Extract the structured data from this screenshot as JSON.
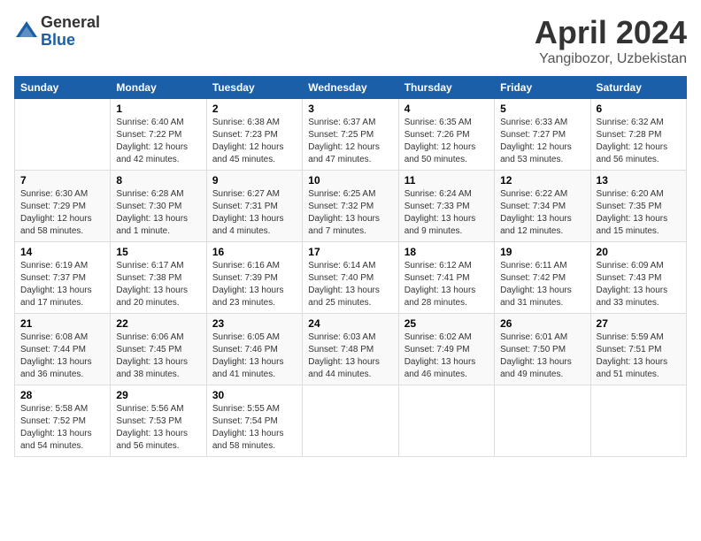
{
  "header": {
    "logo_general": "General",
    "logo_blue": "Blue",
    "month_title": "April 2024",
    "location": "Yangibozor, Uzbekistan"
  },
  "days_of_week": [
    "Sunday",
    "Monday",
    "Tuesday",
    "Wednesday",
    "Thursday",
    "Friday",
    "Saturday"
  ],
  "weeks": [
    [
      {
        "day": "",
        "sunrise": "",
        "sunset": "",
        "daylight": ""
      },
      {
        "day": "1",
        "sunrise": "Sunrise: 6:40 AM",
        "sunset": "Sunset: 7:22 PM",
        "daylight": "Daylight: 12 hours and 42 minutes."
      },
      {
        "day": "2",
        "sunrise": "Sunrise: 6:38 AM",
        "sunset": "Sunset: 7:23 PM",
        "daylight": "Daylight: 12 hours and 45 minutes."
      },
      {
        "day": "3",
        "sunrise": "Sunrise: 6:37 AM",
        "sunset": "Sunset: 7:25 PM",
        "daylight": "Daylight: 12 hours and 47 minutes."
      },
      {
        "day": "4",
        "sunrise": "Sunrise: 6:35 AM",
        "sunset": "Sunset: 7:26 PM",
        "daylight": "Daylight: 12 hours and 50 minutes."
      },
      {
        "day": "5",
        "sunrise": "Sunrise: 6:33 AM",
        "sunset": "Sunset: 7:27 PM",
        "daylight": "Daylight: 12 hours and 53 minutes."
      },
      {
        "day": "6",
        "sunrise": "Sunrise: 6:32 AM",
        "sunset": "Sunset: 7:28 PM",
        "daylight": "Daylight: 12 hours and 56 minutes."
      }
    ],
    [
      {
        "day": "7",
        "sunrise": "Sunrise: 6:30 AM",
        "sunset": "Sunset: 7:29 PM",
        "daylight": "Daylight: 12 hours and 58 minutes."
      },
      {
        "day": "8",
        "sunrise": "Sunrise: 6:28 AM",
        "sunset": "Sunset: 7:30 PM",
        "daylight": "Daylight: 13 hours and 1 minute."
      },
      {
        "day": "9",
        "sunrise": "Sunrise: 6:27 AM",
        "sunset": "Sunset: 7:31 PM",
        "daylight": "Daylight: 13 hours and 4 minutes."
      },
      {
        "day": "10",
        "sunrise": "Sunrise: 6:25 AM",
        "sunset": "Sunset: 7:32 PM",
        "daylight": "Daylight: 13 hours and 7 minutes."
      },
      {
        "day": "11",
        "sunrise": "Sunrise: 6:24 AM",
        "sunset": "Sunset: 7:33 PM",
        "daylight": "Daylight: 13 hours and 9 minutes."
      },
      {
        "day": "12",
        "sunrise": "Sunrise: 6:22 AM",
        "sunset": "Sunset: 7:34 PM",
        "daylight": "Daylight: 13 hours and 12 minutes."
      },
      {
        "day": "13",
        "sunrise": "Sunrise: 6:20 AM",
        "sunset": "Sunset: 7:35 PM",
        "daylight": "Daylight: 13 hours and 15 minutes."
      }
    ],
    [
      {
        "day": "14",
        "sunrise": "Sunrise: 6:19 AM",
        "sunset": "Sunset: 7:37 PM",
        "daylight": "Daylight: 13 hours and 17 minutes."
      },
      {
        "day": "15",
        "sunrise": "Sunrise: 6:17 AM",
        "sunset": "Sunset: 7:38 PM",
        "daylight": "Daylight: 13 hours and 20 minutes."
      },
      {
        "day": "16",
        "sunrise": "Sunrise: 6:16 AM",
        "sunset": "Sunset: 7:39 PM",
        "daylight": "Daylight: 13 hours and 23 minutes."
      },
      {
        "day": "17",
        "sunrise": "Sunrise: 6:14 AM",
        "sunset": "Sunset: 7:40 PM",
        "daylight": "Daylight: 13 hours and 25 minutes."
      },
      {
        "day": "18",
        "sunrise": "Sunrise: 6:12 AM",
        "sunset": "Sunset: 7:41 PM",
        "daylight": "Daylight: 13 hours and 28 minutes."
      },
      {
        "day": "19",
        "sunrise": "Sunrise: 6:11 AM",
        "sunset": "Sunset: 7:42 PM",
        "daylight": "Daylight: 13 hours and 31 minutes."
      },
      {
        "day": "20",
        "sunrise": "Sunrise: 6:09 AM",
        "sunset": "Sunset: 7:43 PM",
        "daylight": "Daylight: 13 hours and 33 minutes."
      }
    ],
    [
      {
        "day": "21",
        "sunrise": "Sunrise: 6:08 AM",
        "sunset": "Sunset: 7:44 PM",
        "daylight": "Daylight: 13 hours and 36 minutes."
      },
      {
        "day": "22",
        "sunrise": "Sunrise: 6:06 AM",
        "sunset": "Sunset: 7:45 PM",
        "daylight": "Daylight: 13 hours and 38 minutes."
      },
      {
        "day": "23",
        "sunrise": "Sunrise: 6:05 AM",
        "sunset": "Sunset: 7:46 PM",
        "daylight": "Daylight: 13 hours and 41 minutes."
      },
      {
        "day": "24",
        "sunrise": "Sunrise: 6:03 AM",
        "sunset": "Sunset: 7:48 PM",
        "daylight": "Daylight: 13 hours and 44 minutes."
      },
      {
        "day": "25",
        "sunrise": "Sunrise: 6:02 AM",
        "sunset": "Sunset: 7:49 PM",
        "daylight": "Daylight: 13 hours and 46 minutes."
      },
      {
        "day": "26",
        "sunrise": "Sunrise: 6:01 AM",
        "sunset": "Sunset: 7:50 PM",
        "daylight": "Daylight: 13 hours and 49 minutes."
      },
      {
        "day": "27",
        "sunrise": "Sunrise: 5:59 AM",
        "sunset": "Sunset: 7:51 PM",
        "daylight": "Daylight: 13 hours and 51 minutes."
      }
    ],
    [
      {
        "day": "28",
        "sunrise": "Sunrise: 5:58 AM",
        "sunset": "Sunset: 7:52 PM",
        "daylight": "Daylight: 13 hours and 54 minutes."
      },
      {
        "day": "29",
        "sunrise": "Sunrise: 5:56 AM",
        "sunset": "Sunset: 7:53 PM",
        "daylight": "Daylight: 13 hours and 56 minutes."
      },
      {
        "day": "30",
        "sunrise": "Sunrise: 5:55 AM",
        "sunset": "Sunset: 7:54 PM",
        "daylight": "Daylight: 13 hours and 58 minutes."
      },
      {
        "day": "",
        "sunrise": "",
        "sunset": "",
        "daylight": ""
      },
      {
        "day": "",
        "sunrise": "",
        "sunset": "",
        "daylight": ""
      },
      {
        "day": "",
        "sunrise": "",
        "sunset": "",
        "daylight": ""
      },
      {
        "day": "",
        "sunrise": "",
        "sunset": "",
        "daylight": ""
      }
    ]
  ]
}
